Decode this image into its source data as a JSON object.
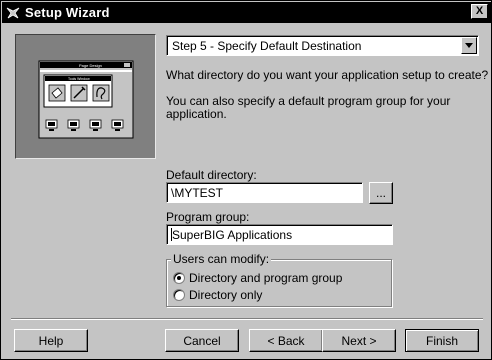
{
  "window": {
    "title": "Setup Wizard",
    "close_glyph": "X"
  },
  "step_dropdown": {
    "value": "Step 5 - Specify Default Destination"
  },
  "instructions": {
    "line1": "What directory do you want your application setup to create?",
    "line2a": "You can also specify a default program group for your",
    "line2b": "application."
  },
  "default_directory": {
    "label": "Default directory:",
    "value": "\\MYTEST",
    "browse_label": "..."
  },
  "program_group": {
    "label": "Program group:",
    "value": "SuperBIG Applications"
  },
  "users_can_modify": {
    "label": "Users can modify:",
    "options": [
      {
        "label": "Directory and program group",
        "selected": true
      },
      {
        "label": "Directory only",
        "selected": false
      }
    ]
  },
  "buttons": {
    "help": "Help",
    "cancel": "Cancel",
    "back": "< Back",
    "next": "Next >",
    "finish": "Finish"
  },
  "preview": {
    "mini_title": "Page  Design",
    "mini_toolbar_title": "Tools  Window"
  },
  "colors": {
    "face": "#c4c4c4",
    "titlebar": "#000000",
    "preview_bg": "#808080"
  }
}
